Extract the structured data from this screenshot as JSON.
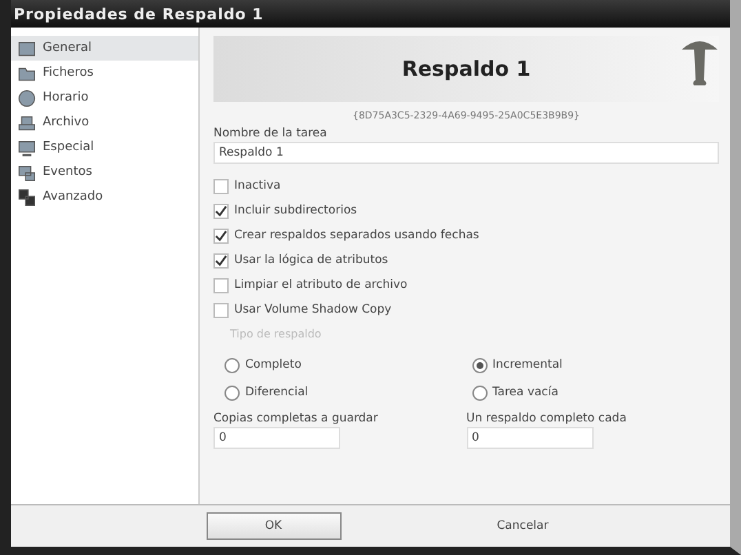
{
  "window": {
    "title": "Propiedades de Respaldo 1"
  },
  "sidebar": {
    "items": [
      {
        "label": "General",
        "selected": true
      },
      {
        "label": "Ficheros",
        "selected": false
      },
      {
        "label": "Horario",
        "selected": false
      },
      {
        "label": "Archivo",
        "selected": false
      },
      {
        "label": "Especial",
        "selected": false
      },
      {
        "label": "Eventos",
        "selected": false
      },
      {
        "label": "Avanzado",
        "selected": false
      }
    ]
  },
  "header": {
    "title": "Respaldo 1",
    "id": "{8D75A3C5-2329-4A69-9495-25A0C5E3B9B9}"
  },
  "task_name": {
    "label": "Nombre de la tarea",
    "value": "Respaldo 1"
  },
  "options": [
    {
      "label": "Inactiva",
      "checked": false
    },
    {
      "label": "Incluir subdirectorios",
      "checked": true
    },
    {
      "label": "Crear respaldos separados usando fechas",
      "checked": true
    },
    {
      "label": "Usar la lógica de atributos",
      "checked": true
    },
    {
      "label": "Limpiar el atributo de archivo",
      "checked": false
    },
    {
      "label": "Usar Volume Shadow Copy",
      "checked": false
    }
  ],
  "backup_type": {
    "label": "Tipo de respaldo",
    "disabled": true,
    "options": [
      {
        "label": "Completo",
        "selected": false
      },
      {
        "label": "Incremental",
        "selected": true
      },
      {
        "label": "Diferencial",
        "selected": false
      },
      {
        "label": "Tarea vacía",
        "selected": false
      }
    ]
  },
  "counts": [
    {
      "label": "Copias completas a guardar",
      "value": "0"
    },
    {
      "label": "Un respaldo completo cada",
      "value": "0"
    }
  ],
  "buttons": [
    {
      "label": "OK",
      "kind": "default"
    },
    {
      "label": "Cancelar",
      "kind": "flat"
    }
  ]
}
